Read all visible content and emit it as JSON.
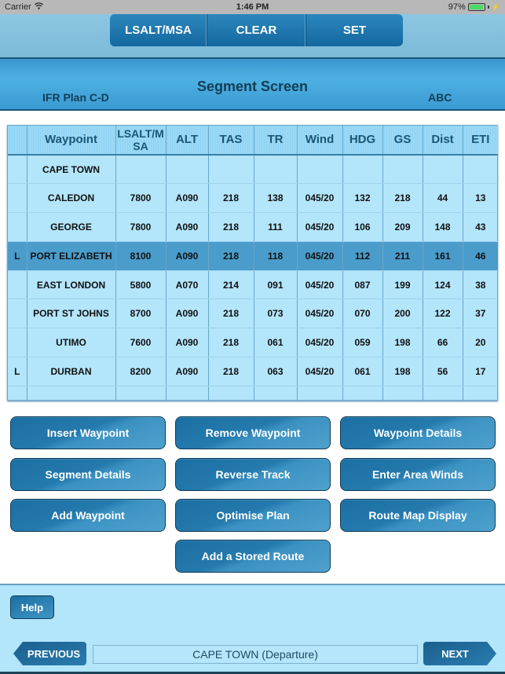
{
  "status_bar": {
    "carrier": "Carrier",
    "wifi_icon": "wifi-icon",
    "time": "1:46 PM",
    "battery_percent": "97%",
    "battery_level": 0.97,
    "charging_icon": "bolt-icon"
  },
  "toolbar": {
    "segments": [
      {
        "label": "LSALT/MSA"
      },
      {
        "label": "CLEAR"
      },
      {
        "label": "SET"
      }
    ]
  },
  "header": {
    "title": "Segment Screen",
    "plan_name": "IFR Plan C-D",
    "user_code": "ABC"
  },
  "table": {
    "columns": [
      "",
      "Waypoint",
      "LSALT/M SA",
      "ALT",
      "TAS",
      "TR",
      "Wind",
      "HDG",
      "GS",
      "Dist",
      "ETI"
    ],
    "rows": [
      {
        "flag": "",
        "waypoint": "CAPE TOWN",
        "lsalt": "",
        "alt": "",
        "tas": "",
        "tr": "",
        "wind": "",
        "hdg": "",
        "gs": "",
        "dist": "",
        "eti": "",
        "selected": false
      },
      {
        "flag": "",
        "waypoint": "CALEDON",
        "lsalt": "7800",
        "alt": "A090",
        "tas": "218",
        "tr": "138",
        "wind": "045/20",
        "hdg": "132",
        "gs": "218",
        "dist": "44",
        "eti": "13",
        "selected": false
      },
      {
        "flag": "",
        "waypoint": "GEORGE",
        "lsalt": "7800",
        "alt": "A090",
        "tas": "218",
        "tr": "111",
        "wind": "045/20",
        "hdg": "106",
        "gs": "209",
        "dist": "148",
        "eti": "43",
        "selected": false
      },
      {
        "flag": "L",
        "waypoint": "PORT ELIZABETH",
        "lsalt": "8100",
        "alt": "A090",
        "tas": "218",
        "tr": "118",
        "wind": "045/20",
        "hdg": "112",
        "gs": "211",
        "dist": "161",
        "eti": "46",
        "selected": true
      },
      {
        "flag": "",
        "waypoint": "EAST LONDON",
        "lsalt": "5800",
        "alt": "A070",
        "tas": "214",
        "tr": "091",
        "wind": "045/20",
        "hdg": "087",
        "gs": "199",
        "dist": "124",
        "eti": "38",
        "selected": false
      },
      {
        "flag": "",
        "waypoint": "PORT ST JOHNS",
        "lsalt": "8700",
        "alt": "A090",
        "tas": "218",
        "tr": "073",
        "wind": "045/20",
        "hdg": "070",
        "gs": "200",
        "dist": "122",
        "eti": "37",
        "selected": false
      },
      {
        "flag": "",
        "waypoint": "UTIMO",
        "lsalt": "7600",
        "alt": "A090",
        "tas": "218",
        "tr": "061",
        "wind": "045/20",
        "hdg": "059",
        "gs": "198",
        "dist": "66",
        "eti": "20",
        "selected": false
      },
      {
        "flag": "L",
        "waypoint": "DURBAN",
        "lsalt": "8200",
        "alt": "A090",
        "tas": "218",
        "tr": "063",
        "wind": "045/20",
        "hdg": "061",
        "gs": "198",
        "dist": "56",
        "eti": "17",
        "selected": false
      }
    ]
  },
  "actions": {
    "insert_waypoint": "Insert Waypoint",
    "remove_waypoint": "Remove Waypoint",
    "waypoint_details": "Waypoint Details",
    "segment_details": "Segment Details",
    "reverse_track": "Reverse Track",
    "enter_area_winds": "Enter Area Winds",
    "add_waypoint": "Add Waypoint",
    "optimise_plan": "Optimise Plan",
    "route_map_display": "Route Map Display",
    "add_stored_route": "Add a Stored Route"
  },
  "footer": {
    "help_label": "Help",
    "previous_label": "PREVIOUS",
    "next_label": "NEXT",
    "current_segment": "CAPE TOWN (Departure)"
  },
  "colors": {
    "accent": "#1b6fa3",
    "selected_row": "#4a9ccb",
    "table_bg": "#b3e5fb",
    "header_bg": "#4eb0e2"
  }
}
